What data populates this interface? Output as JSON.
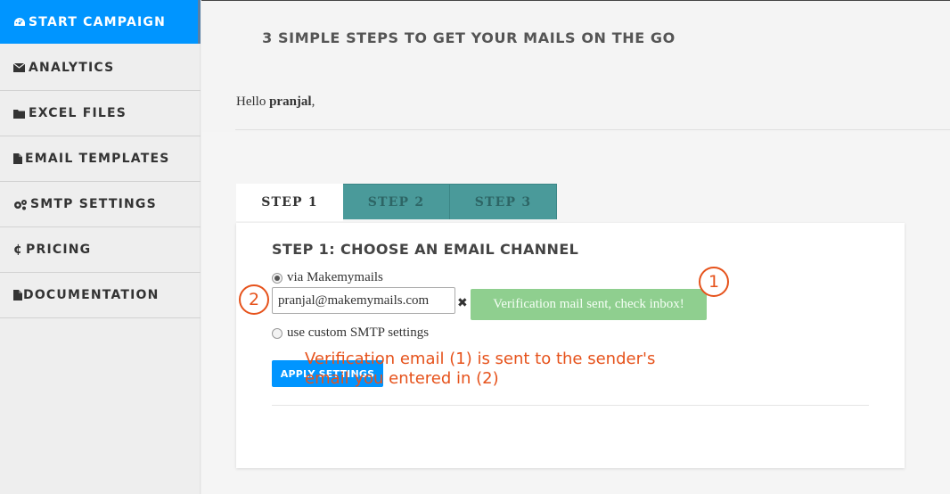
{
  "sidebar": {
    "items": [
      {
        "icon": "dashboard-icon",
        "label": "START CAMPAIGN",
        "active": true
      },
      {
        "icon": "envelope-icon",
        "label": "ANALYTICS"
      },
      {
        "icon": "folder-icon",
        "label": "EXCEL FILES"
      },
      {
        "icon": "file-icon",
        "label": "EMAIL TEMPLATES"
      },
      {
        "icon": "gears-icon",
        "label": "SMTP SETTINGS"
      },
      {
        "icon": "cent-icon",
        "label": "PRICING"
      },
      {
        "icon": "file-icon",
        "label": "DOCUMENTATION"
      }
    ]
  },
  "header": {
    "title": "3 SIMPLE STEPS TO GET YOUR MAILS ON THE GO"
  },
  "greeting": {
    "prefix": "Hello",
    "username": "pranjal",
    "suffix": ","
  },
  "tabs": [
    {
      "label": "STEP 1",
      "active": true
    },
    {
      "label": "STEP 2",
      "active": false
    },
    {
      "label": "STEP 3",
      "active": false
    }
  ],
  "step1": {
    "heading": "STEP 1: CHOOSE AN EMAIL CHANNEL",
    "option_makemymails": {
      "label": "via Makemymails",
      "checked": true
    },
    "email_value": "pranjal@makemymails.com",
    "clear_symbol": "✖",
    "verification_message": "Verification mail sent, check inbox!",
    "option_custom_smtp": {
      "label": "use custom SMTP settings",
      "checked": false
    },
    "apply_label": "APPLY SETTINGS"
  },
  "annotations": {
    "marker1": "1",
    "marker2": "2",
    "note_line1": "Verification email (1) is sent to the sender's",
    "note_line2": "email you entered in (2)",
    "color": "#e6521b"
  },
  "colors": {
    "accent": "#0095ff",
    "tab_inactive": "#4a9a9a",
    "success": "#8fcf8f"
  }
}
